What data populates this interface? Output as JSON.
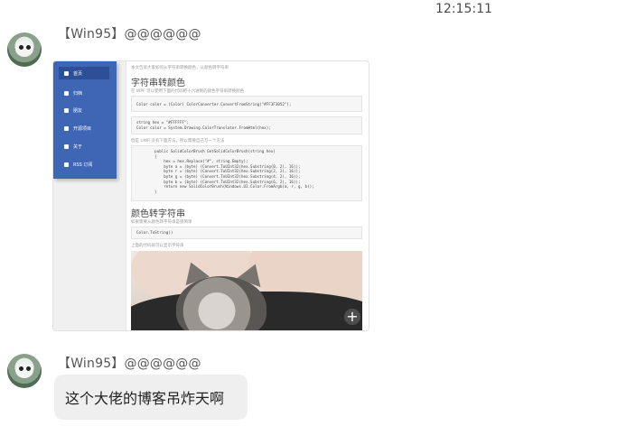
{
  "timestamp": "12:15:11",
  "messages": [
    {
      "sender": "【Win95】@@@@@@"
    },
    {
      "sender": "【Win95】@@@@@@",
      "text": "这个大佬的博客吊炸天啊"
    }
  ],
  "shot": {
    "sidebar": [
      "首页",
      "归档",
      "朋友",
      "开源项目",
      "关于",
      "RSS 订阅"
    ],
    "notes": [
      "本文告诉大家如何从字符串转换颜色，从颜色转字符串",
      "在 WPF 可以使用下面的代码把十六进制的颜色字符串转换颜色",
      "但是 UWP 没有下面方法，所以需要自己写一个方法",
      "如果需要从颜色转字符串是很简单",
      "上面的代码就可以显示字符串"
    ],
    "heading1": "字符串转颜色",
    "heading2": "颜色转字符串",
    "code1": "Color color = (Color) ColorConverter.ConvertFromString(\"#FF3F3052\");",
    "code2": "string hex = \"#FFFFFF\";\nColor color = System.Drawing.ColorTranslator.FromHtml(hex);",
    "code3": "        public SolidColorBrush GetSolidColorBrush(string hex)\n        {\n            hex = hex.Replace(\"#\", string.Empty);\n            byte a = (byte) (Convert.ToUInt32(hex.Substring(0, 2), 16));\n            byte r = (byte) (Convert.ToUInt32(hex.Substring(2, 2), 16));\n            byte g = (byte) (Convert.ToUInt32(hex.Substring(4, 2), 16));\n            byte b = (byte) (Convert.ToUInt32(hex.Substring(6, 2), 16));\n            return new SolidColorBrush(Windows.UI.Color.FromArgb(a, r, g, b));\n        }",
    "code4": "Color.ToString()",
    "zoom_icon": "plus-icon"
  },
  "colors": {
    "sidebar": "#3f66b5",
    "bubble": "#efefef"
  }
}
